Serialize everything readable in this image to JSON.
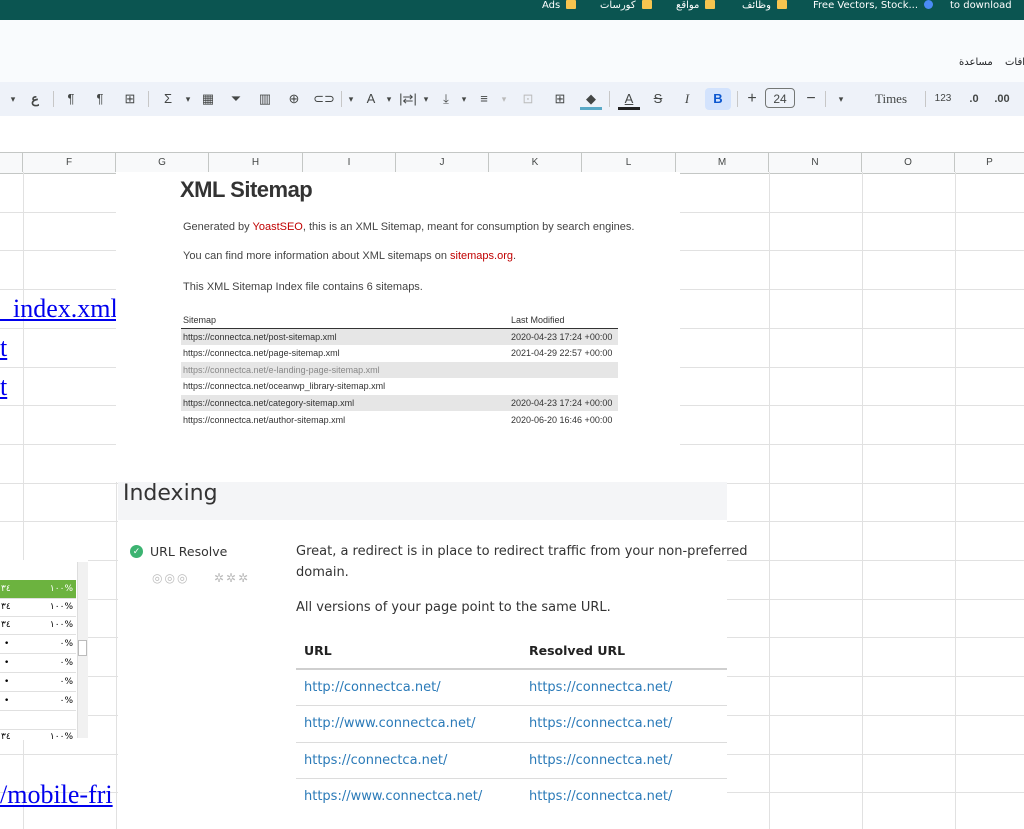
{
  "bookmarks": [
    {
      "label": "Ads",
      "icon": "folder-icon"
    },
    {
      "label": "كورسات",
      "icon": "folder-icon"
    },
    {
      "label": "مواقع",
      "icon": "folder-icon"
    },
    {
      "label": "وظائف",
      "icon": "folder-icon"
    },
    {
      "label": "Free Vectors, Stock...",
      "icon": "folder-icon"
    },
    {
      "label": "to download",
      "icon": "globe-icon"
    }
  ],
  "menu": {
    "help": "مساعدة",
    "extensions": "افات"
  },
  "toolbar": {
    "font": "Times",
    "font_size": "24",
    "number_format": "123",
    "decrease_decimal": ".0",
    "increase_decimal": ".00",
    "bold": "B",
    "italic": "I",
    "sigma": "Σ",
    "plus": "+",
    "minus": "−"
  },
  "columns": [
    "F",
    "G",
    "H",
    "I",
    "J",
    "K",
    "L",
    "M",
    "N",
    "O",
    "P"
  ],
  "cell_links": [
    {
      "text": "_index.xml"
    },
    {
      "text": "t"
    },
    {
      "text": "t"
    },
    {
      "text": "/mobile-fri"
    }
  ],
  "sitemap": {
    "title": "XML Sitemap",
    "generated_prefix": "Generated by ",
    "generator": "YoastSEO",
    "generated_suffix": ", this is an XML Sitemap, meant for consumption by search engines.",
    "info_prefix": "You can find more information about XML sitemaps on ",
    "info_link": "sitemaps.org",
    "info_suffix": ".",
    "index_text": "This XML Sitemap Index file contains 6 sitemaps.",
    "col_sitemap": "Sitemap",
    "col_modified": "Last Modified",
    "rows": [
      {
        "url": "https://connectca.net/post-sitemap.xml",
        "date": "2020-04-23 17:24 +00:00"
      },
      {
        "url": "https://connectca.net/page-sitemap.xml",
        "date": "2021-04-29 22:57 +00:00"
      },
      {
        "url": "https://connectca.net/e-landing-page-sitemap.xml",
        "date": ""
      },
      {
        "url": "https://connectca.net/oceanwp_library-sitemap.xml",
        "date": ""
      },
      {
        "url": "https://connectca.net/category-sitemap.xml",
        "date": "2020-04-23 17:24 +00:00"
      },
      {
        "url": "https://connectca.net/author-sitemap.xml",
        "date": "2020-06-20 16:46 +00:00"
      }
    ]
  },
  "indexing": {
    "title": "Indexing",
    "check_label": "URL Resolve",
    "message_line1": "Great, a redirect is in place to redirect traffic from your non-preferred",
    "message_line2": "domain.",
    "message2": "All versions of your page point to the same URL.",
    "col_url": "URL",
    "col_resolved": "Resolved URL",
    "rows": [
      {
        "url": "http://connectca.net/",
        "resolved": "https://connectca.net/"
      },
      {
        "url": "http://www.connectca.net/",
        "resolved": "https://connectca.net/"
      },
      {
        "url": "https://connectca.net/",
        "resolved": "https://connectca.net/"
      },
      {
        "url": "https://www.connectca.net/",
        "resolved": "https://connectca.net/"
      }
    ]
  },
  "mini_table": {
    "rows": [
      {
        "left": "٣٤",
        "right": "١٠٠%"
      },
      {
        "left": "٣٤",
        "right": "١٠٠%"
      },
      {
        "left": "٣٤",
        "right": "١٠٠%"
      },
      {
        "left": "•",
        "right": "٠%"
      },
      {
        "left": "•",
        "right": "٠%"
      },
      {
        "left": "•",
        "right": "٠%"
      },
      {
        "left": "•",
        "right": "٠%"
      },
      {
        "left": "",
        "right": ""
      },
      {
        "left": "٣٤",
        "right": "١٠٠%"
      }
    ]
  },
  "colors": {
    "bookmarks_bg": "#0b5551",
    "toolbar_bg": "#eef2f9",
    "mini_header": "#6cb33f",
    "link": "#0000ee",
    "check": "#3cb371"
  }
}
